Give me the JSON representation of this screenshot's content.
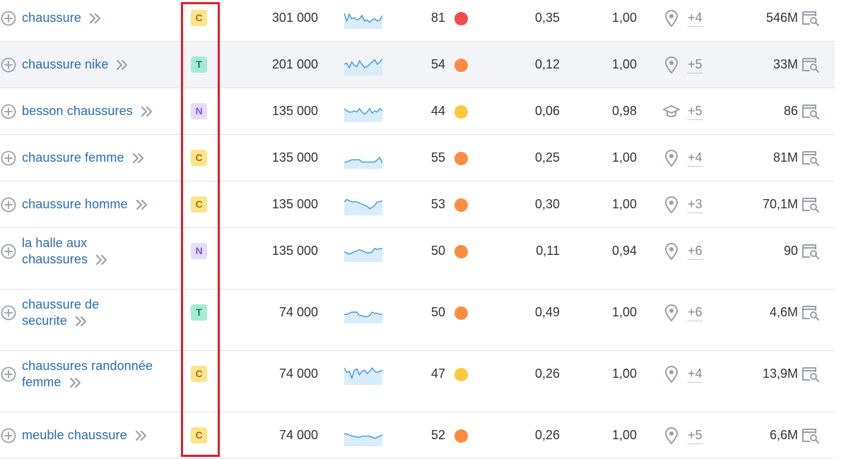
{
  "intent_colors": {
    "C": {
      "bg": "#fde38a",
      "fg": "#a8710c"
    },
    "T": {
      "bg": "#a3ecd3",
      "fg": "#1a7a5c"
    },
    "N": {
      "bg": "#e6dcfa",
      "fg": "#7f5bd4"
    }
  },
  "kd_colors": {
    "red": "#f34b4b",
    "orange": "#fb8c41",
    "yellow": "#fdc93a"
  },
  "rows": [
    {
      "keyword": "chaussure",
      "intent": "C",
      "volume": "301 000",
      "trend": [
        14,
        7,
        13,
        9,
        10,
        8,
        9,
        12,
        7,
        8,
        6,
        8,
        9,
        7,
        8,
        12
      ],
      "kd": "81",
      "kd_level": "red",
      "cpc": "0,35",
      "com": "1,00",
      "feature_icon": "location-pin-icon",
      "features_more": "+4",
      "results": "546M"
    },
    {
      "keyword": "chaussure nike",
      "intent": "T",
      "volume": "201 000",
      "trend": [
        10,
        11,
        7,
        12,
        9,
        8,
        13,
        10,
        7,
        8,
        10,
        12,
        14,
        10,
        12,
        15
      ],
      "kd": "54",
      "kd_level": "orange",
      "cpc": "0,12",
      "com": "1,00",
      "feature_icon": "location-pin-icon",
      "features_more": "+5",
      "results": "33M"
    },
    {
      "keyword": "besson chaussures",
      "intent": "N",
      "volume": "135 000",
      "trend": [
        12,
        10,
        9,
        9,
        10,
        9,
        12,
        9,
        7,
        9,
        12,
        8,
        10,
        9,
        12,
        10
      ],
      "kd": "44",
      "kd_level": "yellow",
      "cpc": "0,06",
      "com": "0,98",
      "feature_icon": "graduation-cap-icon",
      "features_more": "+5",
      "results": "86"
    },
    {
      "keyword": "chaussure femme",
      "intent": "C",
      "volume": "135 000",
      "trend": [
        6,
        6,
        7,
        8,
        8,
        8,
        8,
        6,
        6,
        6,
        6,
        6,
        6,
        8,
        10,
        5
      ],
      "kd": "55",
      "kd_level": "orange",
      "cpc": "0,25",
      "com": "1,00",
      "feature_icon": "location-pin-icon",
      "features_more": "+4",
      "results": "81M"
    },
    {
      "keyword": "chaussure homme",
      "intent": "C",
      "volume": "135 000",
      "trend": [
        12,
        14,
        13,
        12,
        12,
        12,
        11,
        10,
        9,
        8,
        6,
        7,
        9,
        12,
        12,
        13
      ],
      "kd": "53",
      "kd_level": "orange",
      "cpc": "0,30",
      "com": "1,00",
      "feature_icon": "location-pin-icon",
      "features_more": "+3",
      "results": "70,1M"
    },
    {
      "keyword": "la halle aux chaussures",
      "intent": "N",
      "volume": "135 000",
      "trend": [
        9,
        8,
        7,
        8,
        9,
        10,
        11,
        10,
        9,
        8,
        8,
        9,
        12,
        11,
        12,
        12
      ],
      "kd": "50",
      "kd_level": "orange",
      "cpc": "0,11",
      "com": "0,94",
      "feature_icon": "location-pin-icon",
      "features_more": "+6",
      "results": "90"
    },
    {
      "keyword": "chaussure de securite",
      "intent": "T",
      "volume": "74 000",
      "trend": [
        8,
        8,
        9,
        10,
        10,
        10,
        7,
        7,
        6,
        6,
        7,
        10,
        9,
        9,
        8,
        8
      ],
      "kd": "50",
      "kd_level": "orange",
      "cpc": "0,49",
      "com": "1,00",
      "feature_icon": "location-pin-icon",
      "features_more": "+6",
      "results": "4,6M"
    },
    {
      "keyword": "chaussures randonnée femme",
      "intent": "C",
      "volume": "74 000",
      "trend": [
        15,
        11,
        12,
        6,
        13,
        14,
        9,
        12,
        13,
        10,
        12,
        15,
        12,
        11,
        12,
        13
      ],
      "kd": "47",
      "kd_level": "yellow",
      "cpc": "0,26",
      "com": "1,00",
      "feature_icon": "location-pin-icon",
      "features_more": "+4",
      "results": "13,9M"
    },
    {
      "keyword": "meuble chaussure",
      "intent": "C",
      "volume": "74 000",
      "trend": [
        11,
        11,
        10,
        9,
        9,
        8,
        8,
        9,
        9,
        9,
        9,
        8,
        7,
        8,
        9,
        10
      ],
      "kd": "52",
      "kd_level": "orange",
      "cpc": "0,26",
      "com": "1,00",
      "feature_icon": "location-pin-icon",
      "features_more": "+5",
      "results": "6,6M"
    }
  ]
}
